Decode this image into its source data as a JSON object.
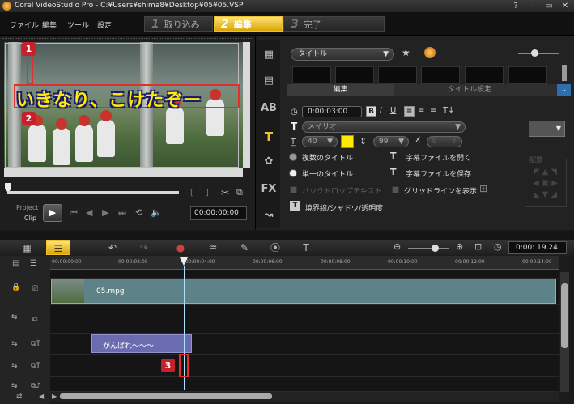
{
  "window": {
    "title": "Corel VideoStudio Pro - C:¥Users¥shima8¥Desktop¥05¥05.VSP",
    "controls": [
      "?",
      "–",
      "▭",
      "✕"
    ]
  },
  "menu": [
    "ファイル",
    "編集",
    "ツール",
    "設定"
  ],
  "steps": [
    {
      "num": "1",
      "label": "取り込み"
    },
    {
      "num": "2",
      "label": "編集"
    },
    {
      "num": "3",
      "label": "完了"
    }
  ],
  "preview": {
    "caption": "いきなり、こけたぞー",
    "markers": [
      "1",
      "2"
    ],
    "project_label": "Project",
    "clip_label": "Clip",
    "timecode": "00:00:00:00"
  },
  "library": {
    "category": "タイトル",
    "tabs": [
      "編集",
      "タイトル設定"
    ],
    "duration": "0:00:03:00",
    "font": "メイリオ",
    "font_size": "40",
    "line_spacing": "99",
    "angle": "0",
    "options": {
      "multi_title": "複数のタイトル",
      "single_title": "単一のタイトル",
      "open_subtitle": "字幕ファイルを開く",
      "save_subtitle": "字幕ファイルを保存",
      "background_text": "バックドロップテキスト",
      "show_grid": "グリッドラインを表示",
      "border_shadow": "境界線/シャドウ/透明度"
    },
    "alignment_label": "配置",
    "accent_color": "#ffea00"
  },
  "timeline": {
    "timecode": "0:00: 19.24",
    "ruler_ticks": [
      "00:00:00:00",
      "00:00:02:00",
      "00:00:04:00",
      "00:00:06:00",
      "00:00:08:00",
      "00:00:10:00",
      "00:00:12:00",
      "00:00:14:00"
    ],
    "video_clip": "05.mpg",
    "title_clip": "がんばれ〜〜〜",
    "marker": "3"
  }
}
